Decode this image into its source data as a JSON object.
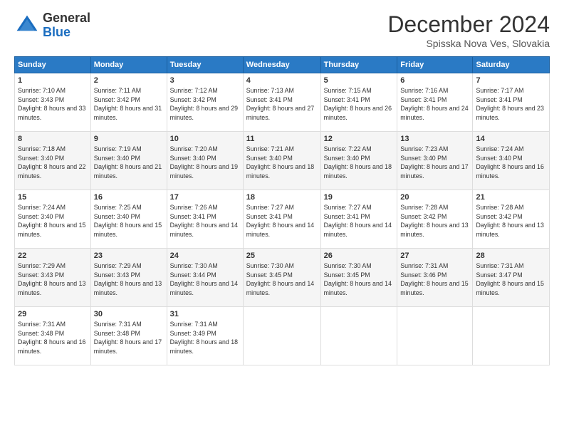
{
  "header": {
    "logo_general": "General",
    "logo_blue": "Blue",
    "month_title": "December 2024",
    "location": "Spisska Nova Ves, Slovakia"
  },
  "days_of_week": [
    "Sunday",
    "Monday",
    "Tuesday",
    "Wednesday",
    "Thursday",
    "Friday",
    "Saturday"
  ],
  "weeks": [
    [
      {
        "day": "1",
        "sunrise": "7:10 AM",
        "sunset": "3:43 PM",
        "daylight": "8 hours and 33 minutes."
      },
      {
        "day": "2",
        "sunrise": "7:11 AM",
        "sunset": "3:42 PM",
        "daylight": "8 hours and 31 minutes."
      },
      {
        "day": "3",
        "sunrise": "7:12 AM",
        "sunset": "3:42 PM",
        "daylight": "8 hours and 29 minutes."
      },
      {
        "day": "4",
        "sunrise": "7:13 AM",
        "sunset": "3:41 PM",
        "daylight": "8 hours and 27 minutes."
      },
      {
        "day": "5",
        "sunrise": "7:15 AM",
        "sunset": "3:41 PM",
        "daylight": "8 hours and 26 minutes."
      },
      {
        "day": "6",
        "sunrise": "7:16 AM",
        "sunset": "3:41 PM",
        "daylight": "8 hours and 24 minutes."
      },
      {
        "day": "7",
        "sunrise": "7:17 AM",
        "sunset": "3:41 PM",
        "daylight": "8 hours and 23 minutes."
      }
    ],
    [
      {
        "day": "8",
        "sunrise": "7:18 AM",
        "sunset": "3:40 PM",
        "daylight": "8 hours and 22 minutes."
      },
      {
        "day": "9",
        "sunrise": "7:19 AM",
        "sunset": "3:40 PM",
        "daylight": "8 hours and 21 minutes."
      },
      {
        "day": "10",
        "sunrise": "7:20 AM",
        "sunset": "3:40 PM",
        "daylight": "8 hours and 19 minutes."
      },
      {
        "day": "11",
        "sunrise": "7:21 AM",
        "sunset": "3:40 PM",
        "daylight": "8 hours and 18 minutes."
      },
      {
        "day": "12",
        "sunrise": "7:22 AM",
        "sunset": "3:40 PM",
        "daylight": "8 hours and 18 minutes."
      },
      {
        "day": "13",
        "sunrise": "7:23 AM",
        "sunset": "3:40 PM",
        "daylight": "8 hours and 17 minutes."
      },
      {
        "day": "14",
        "sunrise": "7:24 AM",
        "sunset": "3:40 PM",
        "daylight": "8 hours and 16 minutes."
      }
    ],
    [
      {
        "day": "15",
        "sunrise": "7:24 AM",
        "sunset": "3:40 PM",
        "daylight": "8 hours and 15 minutes."
      },
      {
        "day": "16",
        "sunrise": "7:25 AM",
        "sunset": "3:40 PM",
        "daylight": "8 hours and 15 minutes."
      },
      {
        "day": "17",
        "sunrise": "7:26 AM",
        "sunset": "3:41 PM",
        "daylight": "8 hours and 14 minutes."
      },
      {
        "day": "18",
        "sunrise": "7:27 AM",
        "sunset": "3:41 PM",
        "daylight": "8 hours and 14 minutes."
      },
      {
        "day": "19",
        "sunrise": "7:27 AM",
        "sunset": "3:41 PM",
        "daylight": "8 hours and 14 minutes."
      },
      {
        "day": "20",
        "sunrise": "7:28 AM",
        "sunset": "3:42 PM",
        "daylight": "8 hours and 13 minutes."
      },
      {
        "day": "21",
        "sunrise": "7:28 AM",
        "sunset": "3:42 PM",
        "daylight": "8 hours and 13 minutes."
      }
    ],
    [
      {
        "day": "22",
        "sunrise": "7:29 AM",
        "sunset": "3:43 PM",
        "daylight": "8 hours and 13 minutes."
      },
      {
        "day": "23",
        "sunrise": "7:29 AM",
        "sunset": "3:43 PM",
        "daylight": "8 hours and 13 minutes."
      },
      {
        "day": "24",
        "sunrise": "7:30 AM",
        "sunset": "3:44 PM",
        "daylight": "8 hours and 14 minutes."
      },
      {
        "day": "25",
        "sunrise": "7:30 AM",
        "sunset": "3:45 PM",
        "daylight": "8 hours and 14 minutes."
      },
      {
        "day": "26",
        "sunrise": "7:30 AM",
        "sunset": "3:45 PM",
        "daylight": "8 hours and 14 minutes."
      },
      {
        "day": "27",
        "sunrise": "7:31 AM",
        "sunset": "3:46 PM",
        "daylight": "8 hours and 15 minutes."
      },
      {
        "day": "28",
        "sunrise": "7:31 AM",
        "sunset": "3:47 PM",
        "daylight": "8 hours and 15 minutes."
      }
    ],
    [
      {
        "day": "29",
        "sunrise": "7:31 AM",
        "sunset": "3:48 PM",
        "daylight": "8 hours and 16 minutes."
      },
      {
        "day": "30",
        "sunrise": "7:31 AM",
        "sunset": "3:48 PM",
        "daylight": "8 hours and 17 minutes."
      },
      {
        "day": "31",
        "sunrise": "7:31 AM",
        "sunset": "3:49 PM",
        "daylight": "8 hours and 18 minutes."
      },
      null,
      null,
      null,
      null
    ]
  ]
}
